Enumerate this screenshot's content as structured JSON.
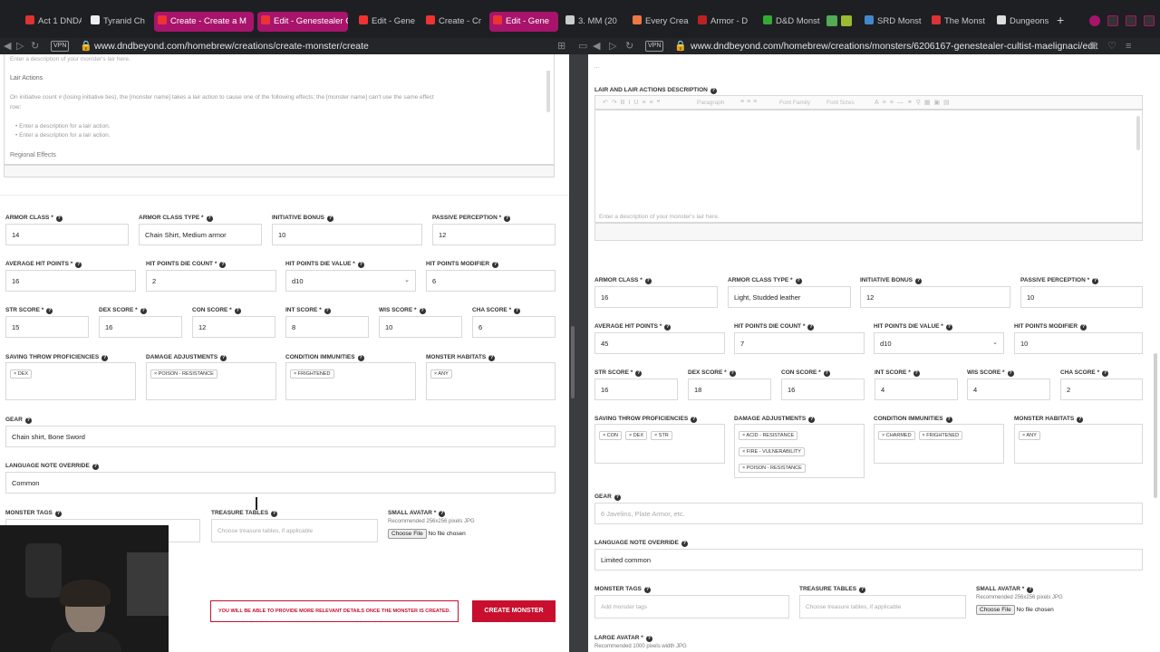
{
  "browser": {
    "tabs": [
      {
        "label": "Act 1 DNDA"
      },
      {
        "label": "Tyranid Ch"
      },
      {
        "label": "Create - Create a M"
      },
      {
        "label": "Edit - Genestealer C"
      },
      {
        "label": "Edit - Gene"
      },
      {
        "label": "Create - Cr"
      },
      {
        "label": "Edit - Gene"
      },
      {
        "label": "3. MM (20"
      },
      {
        "label": "Every Crea"
      },
      {
        "label": "Armor - D"
      },
      {
        "label": "D&D Monst"
      },
      {
        "label": "SRD Monst"
      },
      {
        "label": "The Monst"
      },
      {
        "label": "Dungeons"
      }
    ],
    "new_tab": "+",
    "left_url": "www.dndbeyond.com/homebrew/creations/create-monster/create",
    "right_url": "www.dndbeyond.com/homebrew/creations/monsters/6206167-genestealer-cultist-maelignaci/edit",
    "vpn_label": "VPN"
  },
  "left": {
    "lair_desc_placeholder": "Enter a description of your monster's lair here.",
    "lair_actions_heading": "Lair Actions",
    "lair_actions_text": "On initiative count # (losing initiative ties), the [monster name] takes a lair action to cause one of the following effects; the [monster name] can't use the same effect",
    "lair_actions_text2": "row:",
    "lair_bullet_1": "Enter a description for a lair action.",
    "lair_bullet_2": "Enter a description for a lair action.",
    "regional_effects": "Regional Effects",
    "armor_class_label": "Armor Class *",
    "armor_class": "14",
    "armor_class_type_label": "Armor Class Type *",
    "armor_class_type": "Chain Shirt, Medium armor",
    "initiative_label": "Initiative Bonus",
    "initiative": "10",
    "passive_perception_label": "Passive Perception *",
    "passive_perception": "12",
    "avg_hp_label": "Average Hit Points *",
    "avg_hp": "16",
    "hp_die_count_label": "Hit Points Die Count *",
    "hp_die_count": "2",
    "hp_die_value_label": "Hit Points Die Value *",
    "hp_die_value": "d10",
    "hp_modifier_label": "Hit Points Modifier",
    "hp_modifier": "6",
    "str_label": "STR Score *",
    "str": "15",
    "dex_label": "DEX Score *",
    "dex": "16",
    "con_label": "CON Score *",
    "con": "12",
    "int_label": "INT Score *",
    "int": "8",
    "wis_label": "WIS Score *",
    "wis": "10",
    "cha_label": "CHA Score *",
    "cha": "6",
    "saving_throw_label": "Saving Throw Proficiencies",
    "saving_throws": [
      "× DEX"
    ],
    "damage_adj_label": "Damage Adjustments",
    "damage_adj": [
      "× POISON - RESISTANCE"
    ],
    "condition_imm_label": "Condition Immunities",
    "condition_imm": [
      "× FRIGHTENED"
    ],
    "habitats_label": "Monster Habitats",
    "habitats": [
      "× ANY"
    ],
    "gear_label": "Gear",
    "gear": "Chain shirt, Bone Sword",
    "language_label": "Language Note Override",
    "language": "Common",
    "tags_label": "Monster Tags",
    "treasure_label": "Treasure Tables",
    "treasure_placeholder": "Choose treasure tables, if applicable",
    "avatar_label": "Small Avatar *",
    "avatar_hint": "Recommended 256x256 pixels JPG",
    "choose_file": "Choose File",
    "no_file": "No file chosen",
    "notice": "YOU WILL BE ABLE TO PROVIDE MORE RELEVANT DETAILS ONCE THE MONSTER IS CREATED.",
    "create_button": "CREATE MONSTER"
  },
  "right": {
    "lair_desc_label": "Lair and Lair Actions Description",
    "toolbar_paragraph": "Paragraph",
    "toolbar_font_family": "Font Family",
    "toolbar_font_sizes": "Font Sizes",
    "lair_desc_placeholder": "Enter a description of your monster's lair here.",
    "armor_class_label": "Armor Class *",
    "armor_class": "16",
    "armor_class_type_label": "Armor Class Type *",
    "armor_class_type": "Light, Studded leather",
    "initiative_label": "Initiative Bonus",
    "initiative": "12",
    "passive_perception_label": "Passive Perception *",
    "passive_perception": "10",
    "avg_hp_label": "Average Hit Points *",
    "avg_hp": "45",
    "hp_die_count_label": "Hit Points Die Count *",
    "hp_die_count": "7",
    "hp_die_value_label": "Hit Points Die Value *",
    "hp_die_value": "d10",
    "hp_modifier_label": "Hit Points Modifier",
    "hp_modifier": "10",
    "str_label": "STR Score *",
    "str": "16",
    "dex_label": "DEX Score *",
    "dex": "18",
    "con_label": "CON Score *",
    "con": "16",
    "int_label": "INT Score *",
    "int": "4",
    "wis_label": "WIS Score *",
    "wis": "4",
    "cha_label": "CHA Score *",
    "cha": "2",
    "saving_throw_label": "Saving Throw Proficiencies",
    "saving_throws": [
      "× CON",
      "× DEX",
      "× STR"
    ],
    "damage_adj_label": "Damage Adjustments",
    "damage_adj": [
      "× ACID - RESISTANCE",
      "× FIRE - VULNERABILITY",
      "× POISON - RESISTANCE"
    ],
    "condition_imm_label": "Condition Immunities",
    "condition_imm": [
      "× CHARMED",
      "× FRIGHTENED"
    ],
    "habitats_label": "Monster Habitats",
    "habitats": [
      "× ANY"
    ],
    "gear_label": "Gear",
    "gear_placeholder": "6 Javelins, Plate Armor, etc.",
    "language_label": "Language Note Override",
    "language": "Limited common",
    "tags_label": "Monster Tags",
    "tags_placeholder": "Add monster tags",
    "treasure_label": "Treasure Tables",
    "treasure_placeholder": "Choose treasure tables, if applicable",
    "avatar_label": "Small Avatar *",
    "avatar_hint": "Recommended 256x256 pixels JPG",
    "choose_file": "Choose File",
    "no_file": "No file chosen",
    "large_avatar_label": "Large Avatar *",
    "large_avatar_hint": "Recommended 1000 pixels width JPG"
  },
  "colors": {
    "accent": "#c8102e",
    "tab_active": "#a8146b",
    "browser_bg": "#1d1f23"
  }
}
